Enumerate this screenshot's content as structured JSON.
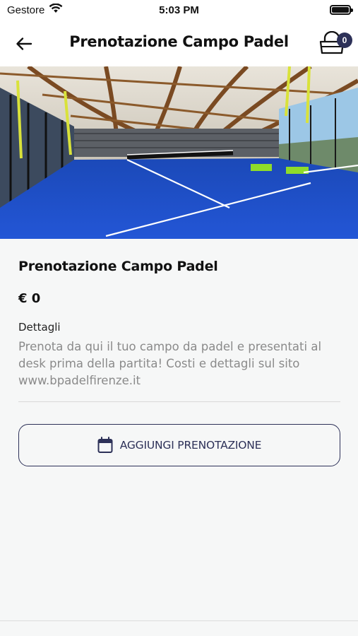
{
  "status_bar": {
    "carrier": "Gestore",
    "time": "5:03 PM",
    "battery_level": 1.0
  },
  "header": {
    "title": "Prenotazione Campo Padel",
    "cart_count": "0"
  },
  "product": {
    "title": "Prenotazione Campo Padel",
    "price": "€ 0",
    "details_label": "Dettagli",
    "details_text": "Prenota da qui il tuo campo da padel e presentati al desk prima della partita! Costi e dettagli sul sito www.bpadelfirenze.it"
  },
  "actions": {
    "add_booking_label": "AGGIUNGI PRENOTAZIONE"
  },
  "colors": {
    "accent": "#2d3158",
    "court_blue": "#1f4fc9",
    "background": "#f6f7f7"
  },
  "icons": {
    "back": "arrow-left-icon",
    "cart": "cart-icon",
    "calendar": "calendar-icon",
    "wifi": "wifi-icon",
    "battery": "battery-icon"
  }
}
